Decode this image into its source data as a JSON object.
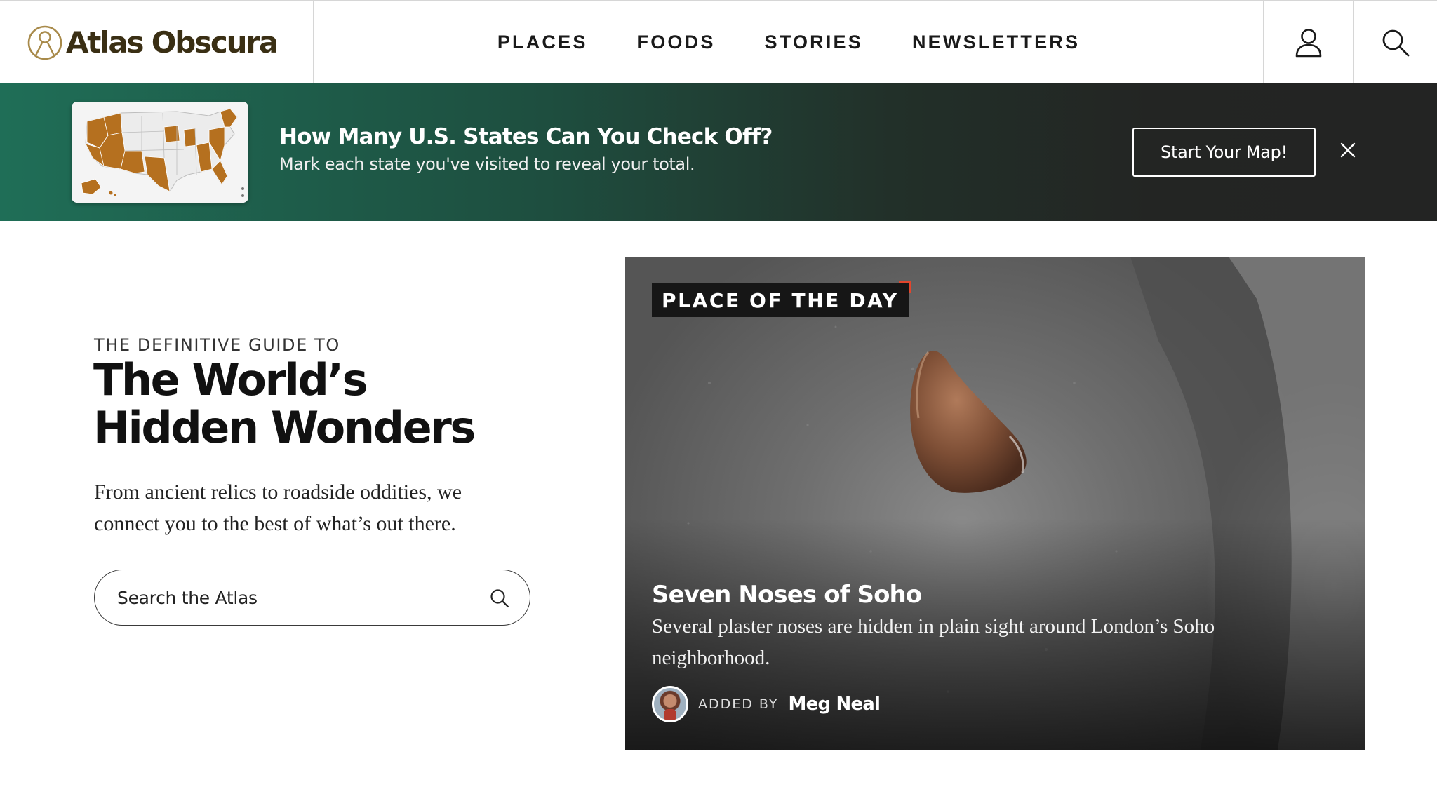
{
  "header": {
    "logo_text": "Atlas Obscura",
    "nav": [
      "PLACES",
      "FOODS",
      "STORIES",
      "NEWSLETTERS"
    ],
    "icons": {
      "account": "user-icon",
      "search": "search-icon"
    }
  },
  "banner": {
    "title": "How Many U.S. States Can You Check Off?",
    "subtitle": "Mark each state you've visited to reveal your total.",
    "cta_label": "Start Your Map!",
    "close_icon": "close-icon",
    "colors": {
      "gradient_start": "#1f6e57",
      "gradient_end": "#232423",
      "map_visited": "#b5701f"
    }
  },
  "hero": {
    "eyebrow": "THE DEFINITIVE GUIDE TO",
    "title_lines": [
      "The World’s",
      "Hidden Wonders"
    ],
    "description_lines": [
      "From ancient relics to roadside oddities, we",
      "connect you to the best of what’s out there."
    ],
    "search_placeholder": "Search the Atlas"
  },
  "feature": {
    "badge": "PLACE OF THE DAY",
    "badge_accent": "#e2452c",
    "title": "Seven Noses of Soho",
    "description_lines": [
      "Several plaster noses are hidden in plain sight around London’s Soho",
      "neighborhood."
    ],
    "added_by_label": "ADDED BY",
    "author": "Meg Neal"
  }
}
